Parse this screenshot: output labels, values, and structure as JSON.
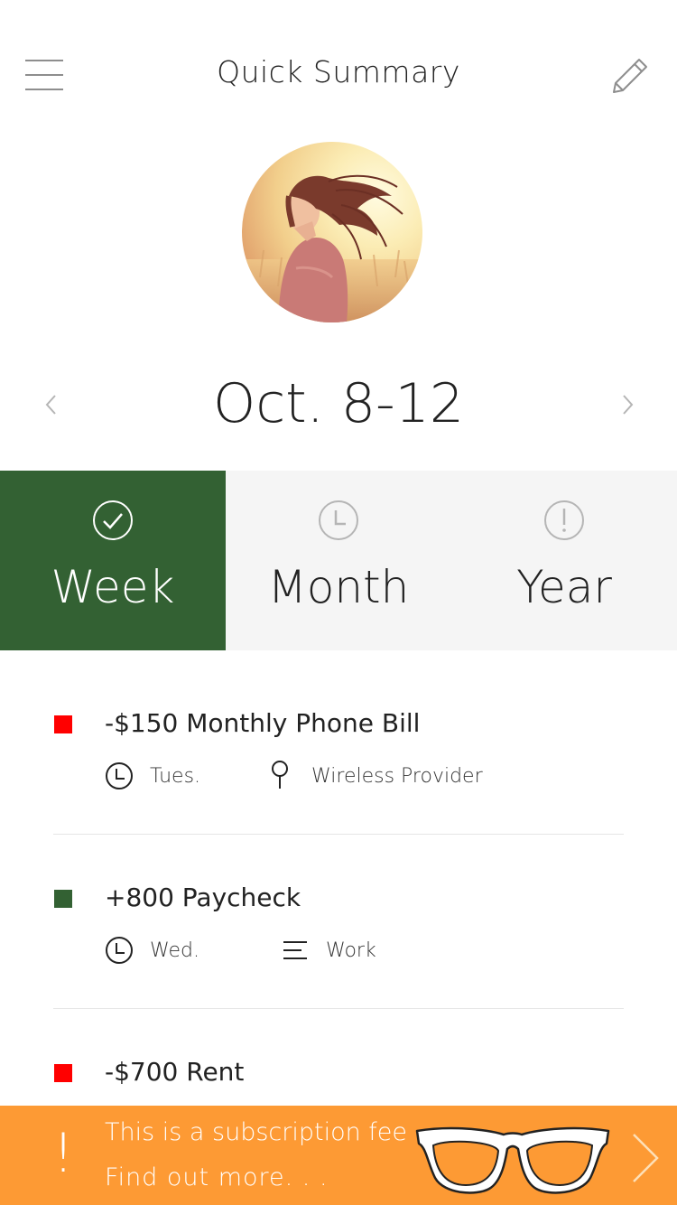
{
  "header": {
    "title": "Quick Summary",
    "menu_icon": "hamburger-menu-icon",
    "edit_icon": "pencil-icon"
  },
  "profile": {
    "avatar_description": "avatar"
  },
  "date_nav": {
    "label": "Oct. 8-12",
    "prev_icon": "chevron-left-icon",
    "next_icon": "chevron-right-icon"
  },
  "tabs": [
    {
      "label": "Week",
      "icon": "check-circle-icon",
      "active": true
    },
    {
      "label": "Month",
      "icon": "clock-icon",
      "active": false
    },
    {
      "label": "Year",
      "icon": "exclamation-circle-icon",
      "active": false
    }
  ],
  "colors": {
    "accent_green": "#336133",
    "expense_red": "#ff0000",
    "income_green": "#336133",
    "banner_orange": "#fd9a34",
    "tab_bg": "#f5f5f5"
  },
  "transactions": [
    {
      "title": "-$150 Monthly Phone Bill",
      "type": "expense",
      "day": "Tues.",
      "detail": "Wireless Provider",
      "detail_icon": "location-pin-icon"
    },
    {
      "title": "+800 Paycheck",
      "type": "income",
      "day": "Wed.",
      "detail": "Work",
      "detail_icon": "lines-icon"
    },
    {
      "title": "-$700 Rent",
      "type": "expense"
    }
  ],
  "banner": {
    "line1": "This is a subscription fee",
    "line2": "Find out more. . .",
    "bang": "!",
    "image_icon": "glasses-icon",
    "chevron_icon": "chevron-right-icon"
  }
}
